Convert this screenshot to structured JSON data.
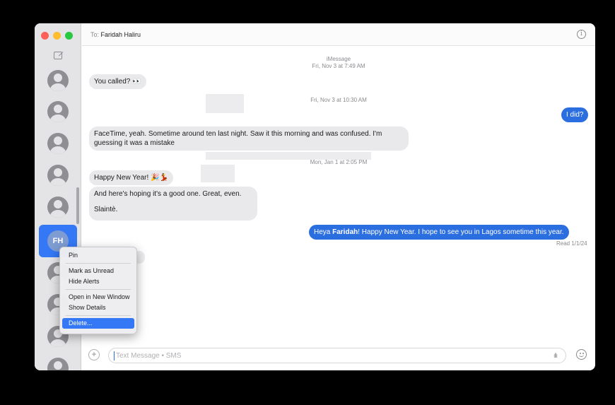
{
  "window": {
    "to_label": "To:",
    "recipient": "Faridah Haliru"
  },
  "colors": {
    "accent": "#3478f6",
    "outgoing_bubble": "#2b6ee0",
    "incoming_bubble": "#e9e9eb",
    "close": "#fe5f57",
    "minimize": "#febc2e",
    "zoom": "#28c840"
  },
  "sidebar": {
    "selected_initials": "FH"
  },
  "conversation": {
    "header": {
      "service": "iMessage",
      "date": "Fri, Nov 3 at 7:49 AM"
    },
    "stamp2": "Fri, Nov 3 at 10:30 AM",
    "stamp3": "Mon, Jan 1 at 2:05 PM",
    "msg1": "You called? 👀",
    "msg2": "I did?",
    "msg3": "FaceTime, yeah. Sometime around ten last night. Saw it this morning and was confused. I'm guessing it was a mistake",
    "msg4": "Happy New Year! 🎉💃",
    "msg5": "And here's hoping it's a good one. Great, even.",
    "msg6": "Slaintè.",
    "msg7_prefix": "Heya ",
    "msg7_name": "Faridah",
    "msg7_suffix": "! Happy New Year. I hope to see you in Lagos sometime this year.",
    "read_receipt": "Read 1/1/24"
  },
  "input": {
    "placeholder": "Text Message • SMS",
    "plus_label": "+",
    "audio_icon": "audio-wave-icon",
    "emoji_icon": "emoji-icon"
  },
  "context_menu": {
    "pin": "Pin",
    "mark_unread": "Mark as Unread",
    "hide_alerts": "Hide Alerts",
    "open_window": "Open in New Window",
    "show_details": "Show Details",
    "delete": "Delete..."
  },
  "icons": {
    "info": "info-icon",
    "compose": "compose-icon",
    "person": "person-avatar-icon"
  }
}
